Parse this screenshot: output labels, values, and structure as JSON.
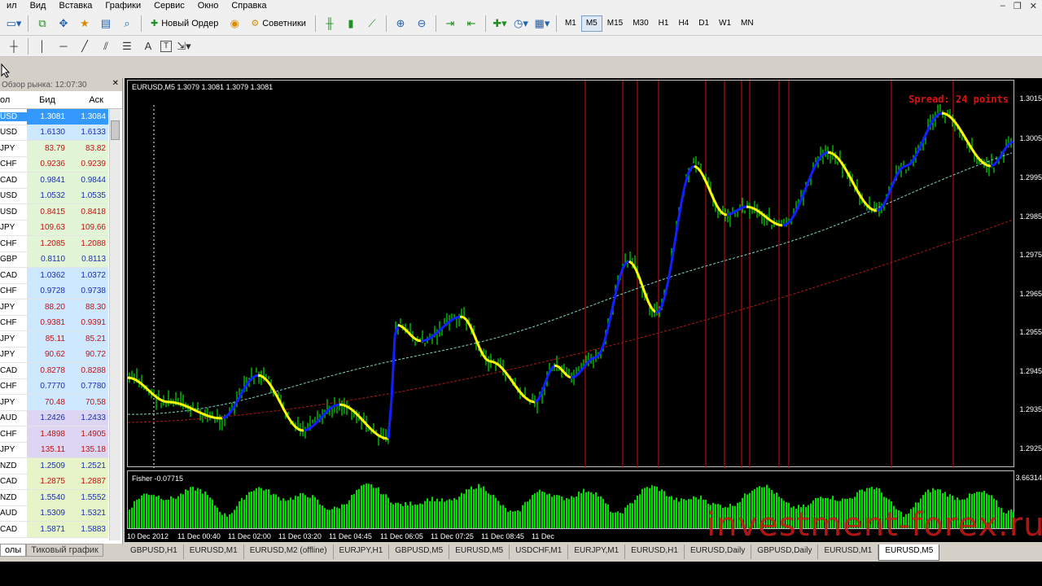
{
  "menu": [
    "ил",
    "Вид",
    "Вставка",
    "Графики",
    "Сервис",
    "Окно",
    "Справка"
  ],
  "toolbar": {
    "new_order": "Новый Ордер",
    "experts": "Советники",
    "timeframes": [
      "M1",
      "M5",
      "M15",
      "M30",
      "H1",
      "H4",
      "D1",
      "W1",
      "MN"
    ],
    "active_tf": "M5"
  },
  "toolbar2": {
    "text_tool": "A",
    "label_tool": "T"
  },
  "market_watch": {
    "title": "Обзор рынка: 12:07:30",
    "col_symbol": "ол",
    "col_bid": "Бид",
    "col_ask": "Аск",
    "tabs": [
      "олы",
      "Тиковый график"
    ],
    "rows": [
      {
        "sym": "USD",
        "bid": "1.3081",
        "ask": "1.3084",
        "bid_color": "#ffffff",
        "ask_color": "#ffffff",
        "bg": "#3399ff",
        "selected": true
      },
      {
        "sym": "USD",
        "bid": "1.6130",
        "ask": "1.6133",
        "bid_color": "#1a2fb0",
        "ask_color": "#1a2fb0",
        "bg": "#cde8ff"
      },
      {
        "sym": "JPY",
        "bid": "83.79",
        "ask": "83.82",
        "bid_color": "#c41010",
        "ask_color": "#c41010",
        "bg": "#e2f5d6"
      },
      {
        "sym": "CHF",
        "bid": "0.9236",
        "ask": "0.9239",
        "bid_color": "#c41010",
        "ask_color": "#c41010",
        "bg": "#e2f5d6"
      },
      {
        "sym": "CAD",
        "bid": "0.9841",
        "ask": "0.9844",
        "bid_color": "#1a2fb0",
        "ask_color": "#1a2fb0",
        "bg": "#e2f5d6"
      },
      {
        "sym": "USD",
        "bid": "1.0532",
        "ask": "1.0535",
        "bid_color": "#1a2fb0",
        "ask_color": "#1a2fb0",
        "bg": "#e2f5d6"
      },
      {
        "sym": "USD",
        "bid": "0.8415",
        "ask": "0.8418",
        "bid_color": "#c41010",
        "ask_color": "#c41010",
        "bg": "#e2f5d6"
      },
      {
        "sym": "JPY",
        "bid": "109.63",
        "ask": "109.66",
        "bid_color": "#c41010",
        "ask_color": "#c41010",
        "bg": "#e2f5d6"
      },
      {
        "sym": "CHF",
        "bid": "1.2085",
        "ask": "1.2088",
        "bid_color": "#c41010",
        "ask_color": "#c41010",
        "bg": "#e2f5d6"
      },
      {
        "sym": "GBP",
        "bid": "0.8110",
        "ask": "0.8113",
        "bid_color": "#1a2fb0",
        "ask_color": "#1a2fb0",
        "bg": "#e2f5d6"
      },
      {
        "sym": "CAD",
        "bid": "1.0362",
        "ask": "1.0372",
        "bid_color": "#1a2fb0",
        "ask_color": "#1a2fb0",
        "bg": "#cde8ff"
      },
      {
        "sym": "CHF",
        "bid": "0.9728",
        "ask": "0.9738",
        "bid_color": "#1a2fb0",
        "ask_color": "#1a2fb0",
        "bg": "#cde8ff"
      },
      {
        "sym": "JPY",
        "bid": "88.20",
        "ask": "88.30",
        "bid_color": "#c41010",
        "ask_color": "#c41010",
        "bg": "#cde8ff"
      },
      {
        "sym": "CHF",
        "bid": "0.9381",
        "ask": "0.9391",
        "bid_color": "#c41010",
        "ask_color": "#c41010",
        "bg": "#cde8ff"
      },
      {
        "sym": "JPY",
        "bid": "85.11",
        "ask": "85.21",
        "bid_color": "#c41010",
        "ask_color": "#c41010",
        "bg": "#cde8ff"
      },
      {
        "sym": "JPY",
        "bid": "90.62",
        "ask": "90.72",
        "bid_color": "#c41010",
        "ask_color": "#c41010",
        "bg": "#cde8ff"
      },
      {
        "sym": "CAD",
        "bid": "0.8278",
        "ask": "0.8288",
        "bid_color": "#c41010",
        "ask_color": "#c41010",
        "bg": "#cde8ff"
      },
      {
        "sym": "CHF",
        "bid": "0.7770",
        "ask": "0.7780",
        "bid_color": "#1a2fb0",
        "ask_color": "#1a2fb0",
        "bg": "#cde8ff"
      },
      {
        "sym": "JPY",
        "bid": "70.48",
        "ask": "70.58",
        "bid_color": "#c41010",
        "ask_color": "#c41010",
        "bg": "#cde8ff"
      },
      {
        "sym": "AUD",
        "bid": "1.2426",
        "ask": "1.2433",
        "bid_color": "#1a2fb0",
        "ask_color": "#1a2fb0",
        "bg": "#dcd6f2"
      },
      {
        "sym": "CHF",
        "bid": "1.4898",
        "ask": "1.4905",
        "bid_color": "#c41010",
        "ask_color": "#c41010",
        "bg": "#dcd6f2"
      },
      {
        "sym": "JPY",
        "bid": "135.11",
        "ask": "135.18",
        "bid_color": "#c41010",
        "ask_color": "#c41010",
        "bg": "#dcd6f2"
      },
      {
        "sym": "NZD",
        "bid": "1.2509",
        "ask": "1.2521",
        "bid_color": "#1a2fb0",
        "ask_color": "#1a2fb0",
        "bg": "#e6f4c8"
      },
      {
        "sym": "CAD",
        "bid": "1.2875",
        "ask": "1.2887",
        "bid_color": "#c41010",
        "ask_color": "#c41010",
        "bg": "#e6f4c8"
      },
      {
        "sym": "NZD",
        "bid": "1.5540",
        "ask": "1.5552",
        "bid_color": "#1a2fb0",
        "ask_color": "#1a2fb0",
        "bg": "#e6f4c8"
      },
      {
        "sym": "AUD",
        "bid": "1.5309",
        "ask": "1.5321",
        "bid_color": "#1a2fb0",
        "ask_color": "#1a2fb0",
        "bg": "#e6f4c8"
      },
      {
        "sym": "CAD",
        "bid": "1.5871",
        "ask": "1.5883",
        "bid_color": "#1a2fb0",
        "ask_color": "#1a2fb0",
        "bg": "#e6f4c8"
      }
    ]
  },
  "chart": {
    "info": "EURUSD,M5  1.3079 1.3081 1.3079 1.3081",
    "spread": "Spread: 24 points",
    "price_labels": [
      "1.3015",
      "1.3005",
      "1.2995",
      "1.2985",
      "1.2975",
      "1.2965",
      "1.2955",
      "1.2945",
      "1.2935",
      "1.2925"
    ],
    "fisher_info": "Fisher -0.07715",
    "fisher_top": "3.66314",
    "time_labels": [
      "10 Dec 2012",
      "11 Dec 00:40",
      "11 Dec 02:00",
      "11 Dec 03:20",
      "11 Dec 04:45",
      "11 Dec 06:05",
      "11 Dec 07:25",
      "11 Dec 08:45",
      "11 Dec"
    ],
    "watermark": "investment-forex.ru",
    "colors": {
      "bull": "#00e000",
      "fast_down": "#ffff00",
      "fast_up": "#1020ff",
      "ma_fast": "#7fd4c8",
      "ma_slow": "#b01818",
      "vlines": "#d01010"
    }
  },
  "chart_tabs": [
    "GBPUSD,H1",
    "EURUSD,M1",
    "EURUSD,M2 (offline)",
    "EURJPY,H1",
    "GBPUSD,M5",
    "EURUSD,M5",
    "USDCHF,M1",
    "EURJPY,M1",
    "EURUSD,H1",
    "EURUSD,Daily",
    "GBPUSD,Daily",
    "EURUSD,M1",
    "EURUSD,M5"
  ],
  "active_tab_index": 12
}
